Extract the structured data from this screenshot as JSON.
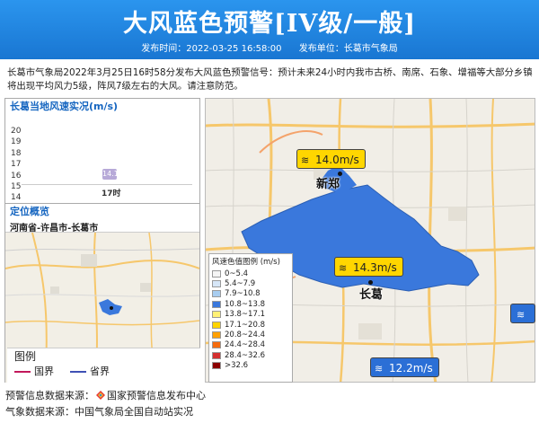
{
  "header": {
    "title": "大风蓝色预警[IV级/一般]",
    "publish_time_label": "发布时间：2022-03-25 16:58:00",
    "publish_unit_label": "发布单位：长葛市气象局"
  },
  "description": "长葛市气象局2022年3月25日16时58分发布大风蓝色预警信号：预计未来24小时内我市古桥、南席、石象、增福等大部分乡镇将出现平均风力5级，阵风7级左右的大风。请注意防范。",
  "speed_panel": {
    "title": "长葛当地风速实况(m/s)",
    "y_ticks": [
      "20",
      "19",
      "18",
      "17",
      "16",
      "15",
      "14"
    ],
    "value_label": "14.1",
    "x_tick": "17时"
  },
  "locate_panel": {
    "title": "定位概览",
    "region": "河南省-许昌市-长葛市"
  },
  "map_legend": {
    "title": "图例",
    "items": [
      {
        "label": "国界",
        "color": "#c2185b"
      },
      {
        "label": "省界",
        "color": "#3f51b5"
      }
    ]
  },
  "speed_legend": {
    "title": "风速色值图例 (m/s)",
    "items": [
      {
        "label": "0~5.4",
        "color": "#f5f5f5"
      },
      {
        "label": "5.4~7.9",
        "color": "#d6e6f7"
      },
      {
        "label": "7.9~10.8",
        "color": "#a8cdf0"
      },
      {
        "label": "10.8~13.8",
        "color": "#3a78dc"
      },
      {
        "label": "13.8~17.1",
        "color": "#fff176"
      },
      {
        "label": "17.1~20.8",
        "color": "#ffd400"
      },
      {
        "label": "20.8~24.4",
        "color": "#ffa000"
      },
      {
        "label": "24.4~28.4",
        "color": "#f56c0d"
      },
      {
        "label": "28.4~32.6",
        "color": "#d32f2f"
      },
      {
        "label": ">32.6",
        "color": "#8b0000"
      }
    ]
  },
  "main_map": {
    "cities": [
      "新郑",
      "长葛"
    ],
    "badges": [
      {
        "text": "14.0m/s",
        "style": "yellow"
      },
      {
        "text": "14.3m/s",
        "style": "yellow"
      },
      {
        "text": "12.2m/s",
        "style": "blue"
      }
    ],
    "area_color": "#3a78dc"
  },
  "sources": {
    "warning_source": "预警信息数据来源：",
    "warning_source_name": "国家预警信息发布中心",
    "weather_source": "气象数据来源：中国气象局全国自动站实况"
  }
}
